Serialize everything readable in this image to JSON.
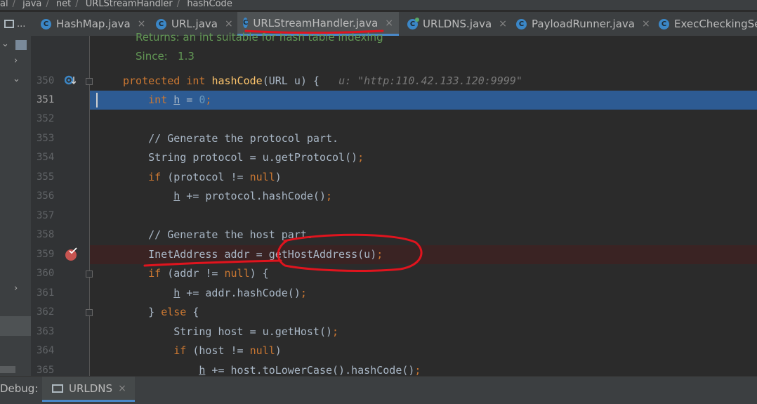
{
  "breadcrumb": {
    "items": [
      "al",
      "java",
      "net",
      "URLStreamHandler",
      "hashCode"
    ]
  },
  "project_button_label": "...",
  "tabs": [
    {
      "label": "HashMap.java",
      "active": false
    },
    {
      "label": "URL.java",
      "active": false
    },
    {
      "label": "URLStreamHandler.java",
      "active": true
    },
    {
      "label": "URLDNS.java",
      "active": false
    },
    {
      "label": "PayloadRunner.java",
      "active": false
    },
    {
      "label": "ExecCheckingSe",
      "active": false
    }
  ],
  "tab_icon_letter": "C",
  "close_glyph": "×",
  "doc": {
    "returns_line": "Returns: an int suitable for hash table indexing",
    "since_label": "Since:",
    "since_value": "1.3"
  },
  "lines": [
    {
      "n": "350",
      "hint": "u: \"http:110.42.133.120:9999\""
    },
    {
      "n": "351"
    },
    {
      "n": "352"
    },
    {
      "n": "353"
    },
    {
      "n": "354"
    },
    {
      "n": "355"
    },
    {
      "n": "356"
    },
    {
      "n": "357"
    },
    {
      "n": "358"
    },
    {
      "n": "359"
    },
    {
      "n": "360"
    },
    {
      "n": "361"
    },
    {
      "n": "362"
    },
    {
      "n": "363"
    },
    {
      "n": "364"
    },
    {
      "n": "365"
    }
  ],
  "debug": {
    "label": "Debug:",
    "tab": "URLDNS"
  },
  "colors": {
    "current_line": "#2d5b93",
    "breakpoint": "#c75450",
    "annotation": "#e0141e",
    "keyword": "#cc7832"
  }
}
